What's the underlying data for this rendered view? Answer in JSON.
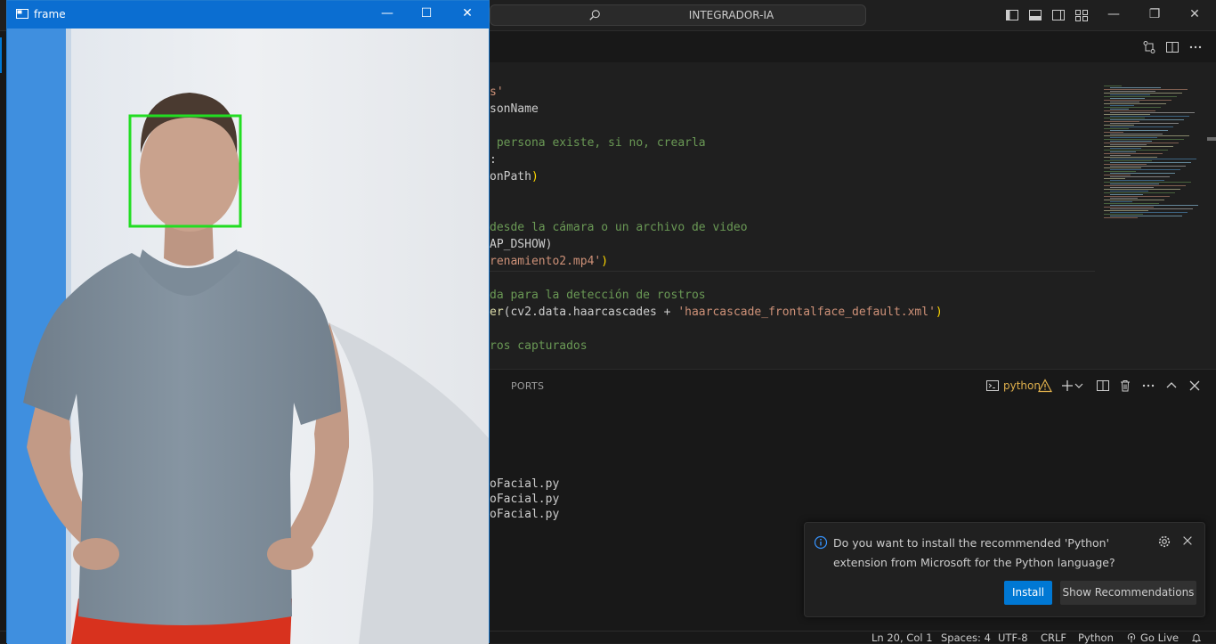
{
  "vscode": {
    "command_center": {
      "label": "INTEGRADOR-IA"
    },
    "editor": {
      "lines": [
        {
          "segments": [
            {
              "t": "s'",
              "c": "string"
            }
          ]
        },
        {
          "segments": [
            {
              "t": "sonName",
              "c": "default"
            }
          ]
        },
        {
          "segments": []
        },
        {
          "segments": [
            {
              "t": " persona existe, si no, crearla",
              "c": "comment"
            }
          ]
        },
        {
          "segments": [
            {
              "t": ":",
              "c": "default"
            }
          ]
        },
        {
          "segments": [
            {
              "t": "onPath",
              "c": "default"
            },
            {
              "t": ")",
              "c": "paren"
            }
          ]
        },
        {
          "segments": []
        },
        {
          "segments": []
        },
        {
          "segments": [
            {
              "t": "desde la cámara o un archivo de video",
              "c": "comment"
            }
          ]
        },
        {
          "segments": [
            {
              "t": "AP_DSHOW)",
              "c": "default"
            }
          ]
        },
        {
          "segments": [
            {
              "t": "renamiento2.mp4'",
              "c": "string"
            },
            {
              "t": ")",
              "c": "paren"
            }
          ]
        },
        {
          "segments": []
        },
        {
          "segments": [
            {
              "t": "da para la detección de rostros",
              "c": "comment"
            }
          ]
        },
        {
          "segments": [
            {
              "t": "er",
              "c": "func"
            },
            {
              "t": "(cv2.data.haarcascades + ",
              "c": "default"
            },
            {
              "t": "'haarcascade_frontalface_default.xml'",
              "c": "string"
            },
            {
              "t": ")",
              "c": "paren"
            }
          ]
        },
        {
          "segments": []
        },
        {
          "segments": [
            {
              "t": "ros capturados",
              "c": "comment"
            }
          ]
        }
      ]
    },
    "panel": {
      "tab_ports": "PORTS",
      "terminal_name": "python",
      "terminal_lines": [
        "oFacial.py",
        "oFacial.py",
        "oFacial.py"
      ]
    },
    "notification": {
      "message": "Do you want to install the recommended 'Python' extension from Microsoft for the Python language?",
      "install_label": "Install",
      "recommend_label": "Show Recommendations"
    },
    "statusbar": {
      "position": "Ln 20, Col 1",
      "spaces": "Spaces: 4",
      "encoding": "UTF-8",
      "eol": "CRLF",
      "language": "Python",
      "go_live": "Go Live"
    }
  },
  "cv_window": {
    "title": "frame",
    "face_box_color": "#22dd22"
  },
  "colors": {
    "accent": "#0078d4",
    "cv_titlebar": "#0b6ed1",
    "wall": "#e9ecf0",
    "wall_blue": "#3b8ee6",
    "shirt": "#7f8d9a",
    "shorts": "#d8321e",
    "skin": "#c9a28d"
  }
}
